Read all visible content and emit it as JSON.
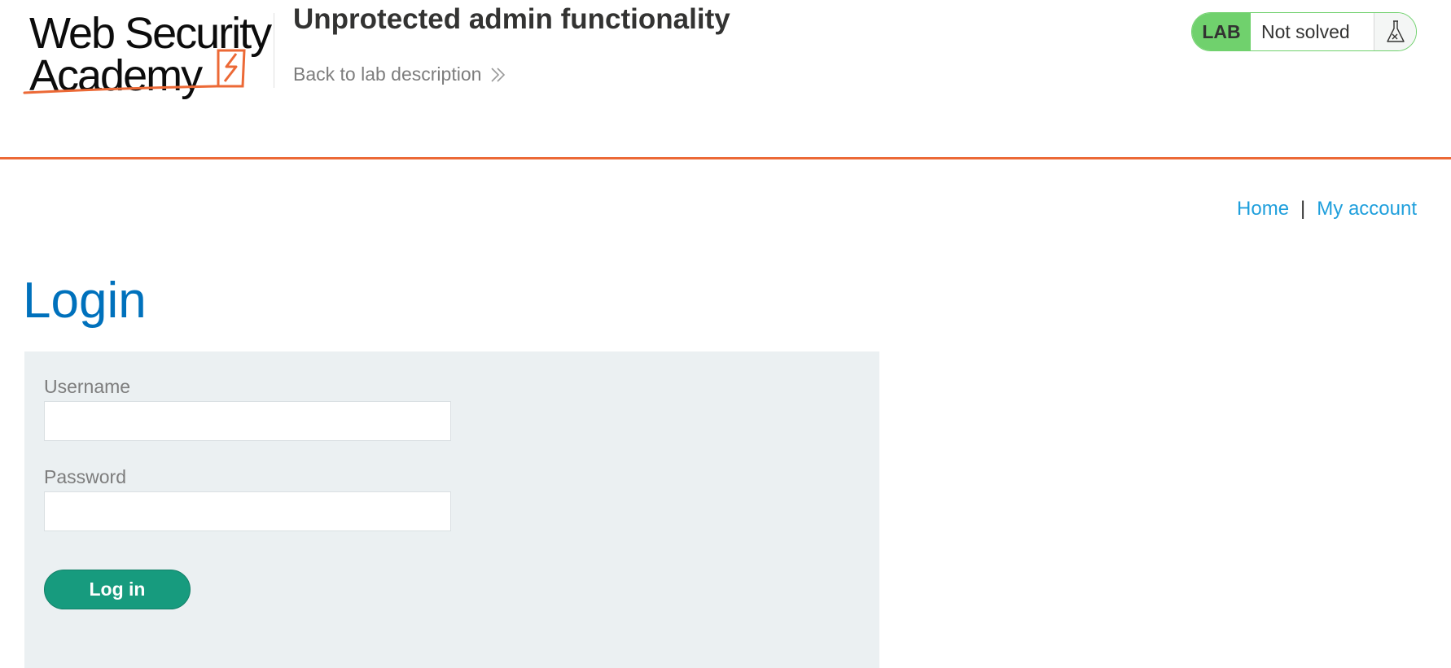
{
  "header": {
    "logo": {
      "line1": "Web Security",
      "line2": "Academy",
      "accent_color": "#ec6936",
      "icon": "lightning-bolt-icon"
    },
    "lab_title": "Unprotected admin functionality",
    "back_link": {
      "label": "Back to lab description",
      "icon": "double-chevron-right-icon"
    },
    "status": {
      "badge": "LAB",
      "text": "Not solved",
      "icon": "flask-icon",
      "color": "#70d16d"
    },
    "divider_color": "#ec6936"
  },
  "nav": {
    "home": "Home",
    "separator": "|",
    "my_account": "My account",
    "link_color": "#1f9fdc"
  },
  "main": {
    "title": "Login",
    "title_color": "#0071bc",
    "form": {
      "username_label": "Username",
      "username_value": "",
      "password_label": "Password",
      "password_value": "",
      "submit_label": "Log in",
      "submit_color": "#179b7e"
    }
  }
}
